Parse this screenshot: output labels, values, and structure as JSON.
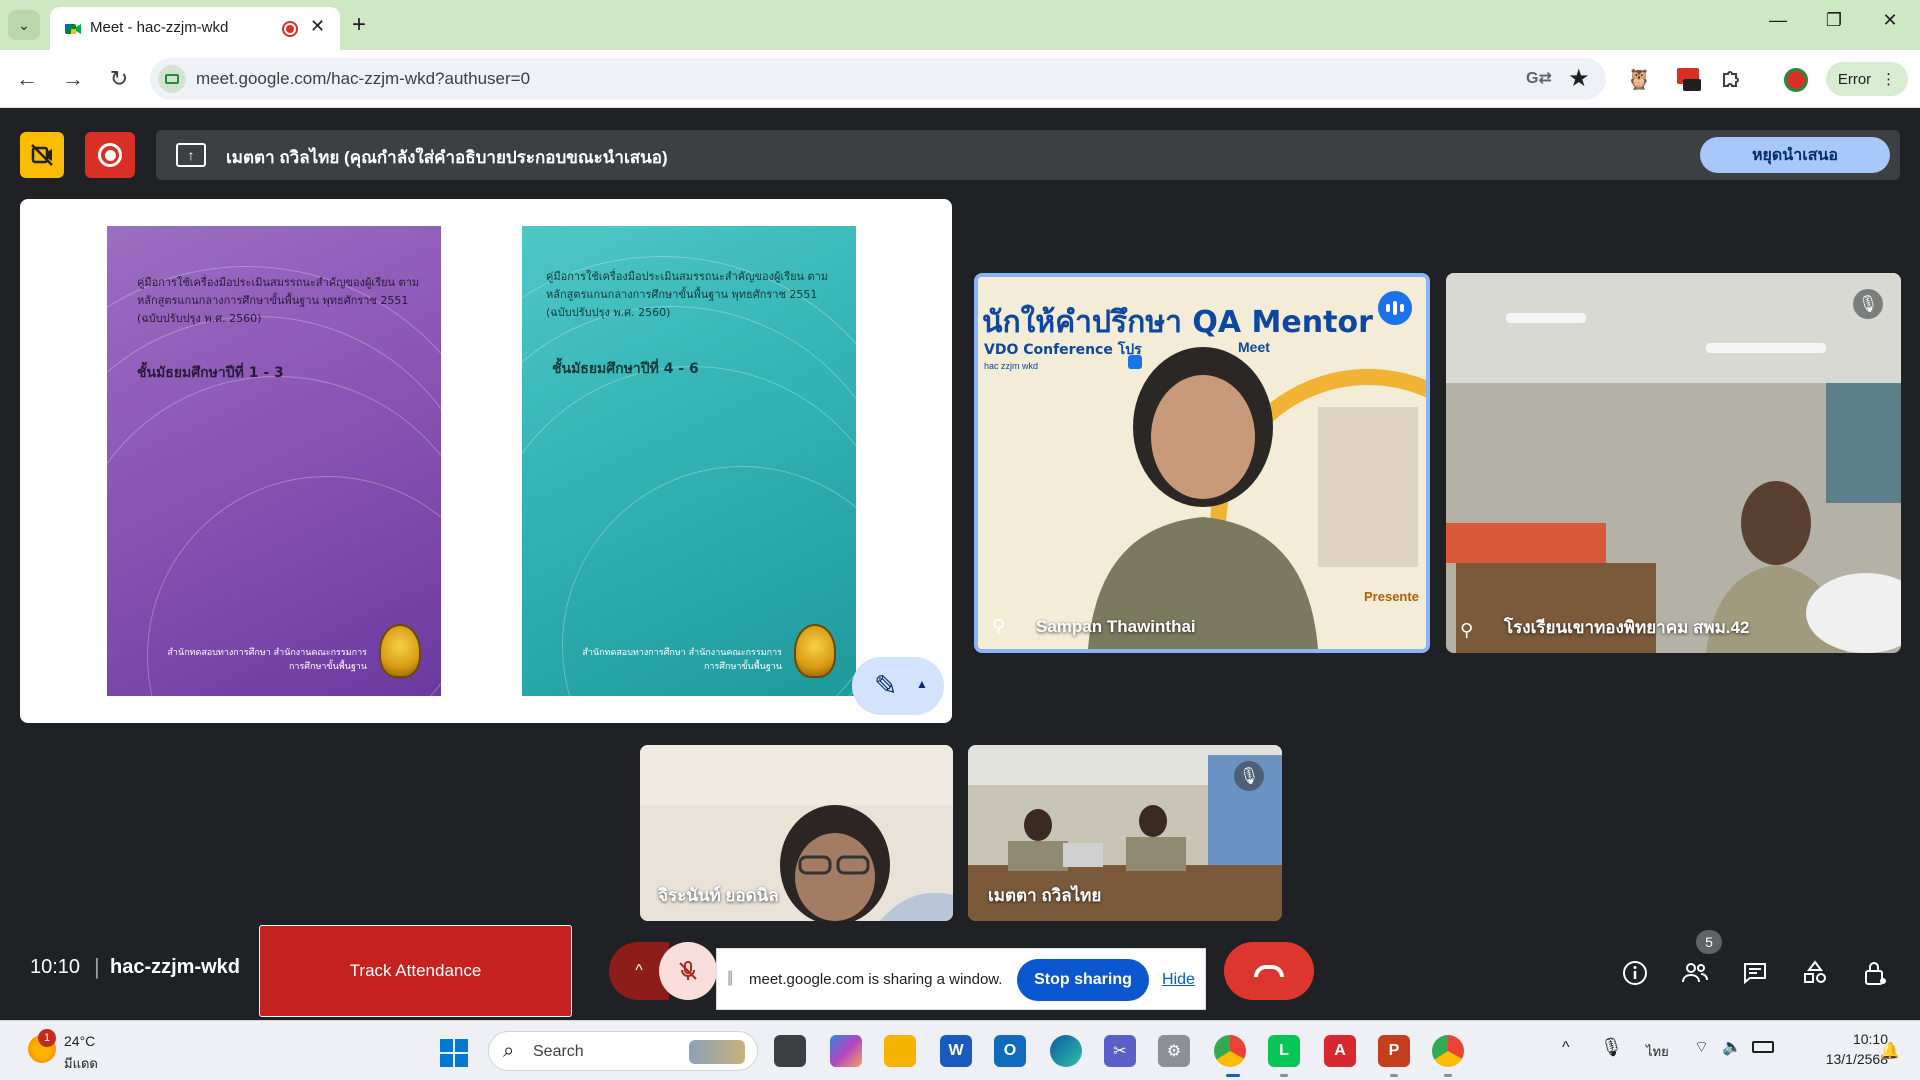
{
  "browser": {
    "tab_title": "Meet - hac-zzjm-wkd",
    "tab_close": "✕",
    "new_tab": "+",
    "url": "meet.google.com/hac-zzjm-wkd?authuser=0",
    "profile_label": "Error",
    "controls": {
      "minimize": "—",
      "restore": "❐",
      "close": "✕"
    }
  },
  "presentation": {
    "banner_text": "เมตตา ถวิลไทย (คุณกำลังใส่คำอธิบายประกอบขณะนำเสนอ)",
    "stop_presenting": "หยุดนำเสนอ",
    "covers": [
      {
        "heading": "คู่มือการใช้เครื่องมือประเมินสมรรถนะสำคัญของผู้เรียน ตามหลักสูตรแกนกลางการศึกษาขั้นพื้นฐาน พุทธศักราช 2551 (ฉบับปรับปรุง พ.ศ. 2560)",
        "level": "ชั้นมัธยมศึกษาปีที่ 1 - 3",
        "publisher": "สำนักทดสอบทางการศึกษา สำนักงานคณะกรรมการการศึกษาขั้นพื้นฐาน",
        "color": "#8a55b6"
      },
      {
        "heading": "คู่มือการใช้เครื่องมือประเมินสมรรถนะสำคัญของผู้เรียน ตามหลักสูตรแกนกลางการศึกษาขั้นพื้นฐาน พุทธศักราช 2551 (ฉบับปรับปรุง พ.ศ. 2560)",
        "level": "ชั้นมัธยมศึกษาปีที่ 4 - 6",
        "publisher": "สำนักทดสอบทางการศึกษา สำนักงานคณะกรรมการการศึกษาขั้นพื้นฐาน",
        "color": "#33b3b4"
      }
    ]
  },
  "participants": [
    {
      "name": "Sampan Thawinthai",
      "speaking": true,
      "muted": false,
      "overlay_text": "นักให้คำปรึกษา QA Mentor",
      "overlay_sub": "VDO Conference โปร",
      "overlay_meet": "Meet",
      "overlay_code": "hac zzjm wkd",
      "overlay_presenter": "Presente"
    },
    {
      "name": "โรงเรียนเขาทองพิทยาคม สพม.42",
      "speaking": false,
      "muted": true
    },
    {
      "name": "จิระนันท์ ยอดนิล",
      "speaking": false,
      "muted": false
    },
    {
      "name": "เมตตา ถวิลไทย",
      "speaking": false,
      "muted": true
    }
  ],
  "meet_bar": {
    "time": "10:10",
    "separator": "|",
    "meeting_code": "hac-zzjm-wkd",
    "track_attendance": "Track Attendance",
    "share_notice": "meet.google.com is sharing a window.",
    "stop_sharing": "Stop sharing",
    "hide": "Hide",
    "people_count": "5"
  },
  "taskbar": {
    "weather_badge": "1",
    "weather_temp": "24°C",
    "weather_condition": "มีแดด",
    "search_label": "Search",
    "language": "ไทย",
    "time": "10:10",
    "date": "13/1/2568"
  },
  "colors": {
    "meet_bg": "#202124",
    "accent_blue": "#8ab4f8",
    "end_call_red": "#dc362e",
    "record_red": "#d93025"
  }
}
